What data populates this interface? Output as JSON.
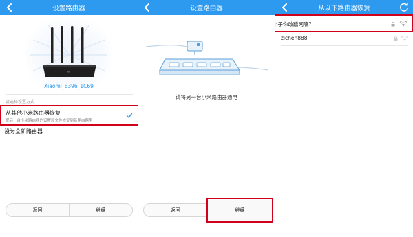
{
  "panel1": {
    "title": "设置路由器",
    "device_name": "Xiaomi_E396_1C69",
    "section_label": "请选择设置方式",
    "option_restore": {
      "title": "从其他小米路由器恢复",
      "desc": "把另一台小米路由器的设置和文件恢复到新路由器里"
    },
    "option_new": "设为全新路由器",
    "back_label": "返回",
    "continue_label": "继续",
    "icons": [
      "back-arrow-icon",
      "router-icon",
      "check-icon"
    ]
  },
  "panel2": {
    "title": "设置路由器",
    "instruction": "请将另一台小米路由器通电",
    "back_label": "返回",
    "continue_label": "继续",
    "icons": [
      "back-arrow-icon",
      "power-strip-icon"
    ]
  },
  "panel3": {
    "title": "从以下路由器恢复",
    "networks": [
      {
        "ssid": "小子你敢蹭网嘛?"
      },
      {
        "ssid": "zichen888"
      }
    ],
    "icons": [
      "back-arrow-icon",
      "refresh-icon",
      "lock-icon",
      "wifi-icon"
    ]
  },
  "colors": {
    "accent": "#2d9af0",
    "highlight": "#d0021b"
  }
}
